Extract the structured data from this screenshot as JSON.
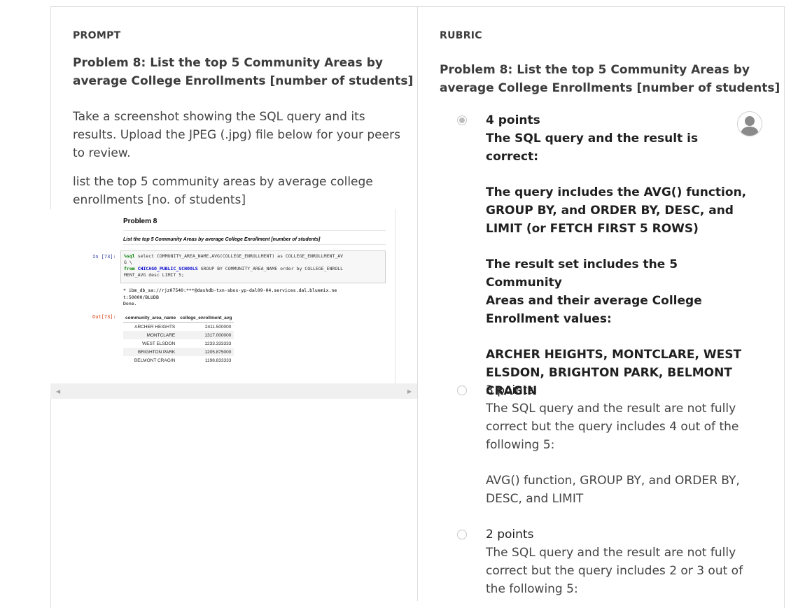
{
  "prompt": {
    "section_label": "PROMPT",
    "title_line1": "Problem 8: List the top 5 Community Areas by",
    "title_line2": "average College Enrollments [number of students]",
    "instructions_line1": "Take a screenshot showing the SQL query and its",
    "instructions_line2": "results. Upload the JPEG (.jpg) file below for your peers",
    "instructions_line3": "to review.",
    "submission_line1": "list the top 5 community areas by average college",
    "submission_line2": "enrollments [no. of students]"
  },
  "notebook": {
    "title": "Problem 8",
    "subtitle": "List the top 5 Community Areas by average College Enrollment [number of students]",
    "in_prompt": "In [73]:",
    "out_prompt": "Out[73]:",
    "code_line1_kw": "%sql",
    "code_line1_rest": " select COMMUNITY_AREA_NAME,AVG(COLLEGE_ENROLLMENT) as COLLEGE_ENROLLMENT_AV",
    "code_line2": "G \\",
    "code_line3_kw": "from",
    "code_line3_tbl": " CHICAGO_PUBLIC_SCHOOLS",
    "code_line3_rest": " GROUP BY COMMUNITY_AREA_NAME order by COLLEGE_ENROLL",
    "code_line4": "MENT_AVG desc LIMIT 5;",
    "stdout_line1": " * ibm_db_sa://rjz07540:***@dashdb-txn-sbox-yp-dal09-04.services.dal.bluemix.ne",
    "stdout_line2": "t:50000/BLUDB",
    "stdout_line3": "Done.",
    "table_headers": [
      "community_area_name",
      "college_enrollment_avg"
    ],
    "table_rows": [
      [
        "ARCHER HEIGHTS",
        "2411.500000"
      ],
      [
        "MONTCLARE",
        "1317.000000"
      ],
      [
        "WEST ELSDON",
        "1233.333333"
      ],
      [
        "BRIGHTON PARK",
        "1205.875000"
      ],
      [
        "BELMONT CRAGIN",
        "1198.833333"
      ]
    ]
  },
  "rubric": {
    "section_label": "RUBRIC",
    "title_line1": "Problem 8: List the top 5 Community Areas by",
    "title_line2": "average College Enrollments [number of students]",
    "options": [
      {
        "points": "4 points",
        "selected": true,
        "lines": [
          "The SQL query and the result is correct:",
          "",
          "The query includes the AVG() function,",
          "GROUP BY, and ORDER BY, DESC, and",
          "LIMIT (or FETCH FIRST 5 ROWS)",
          "",
          "The result set includes the 5 Community",
          "Areas and their average College",
          "Enrollment values:",
          "",
          "ARCHER HEIGHTS, MONTCLARE, WEST",
          "ELSDON, BRIGHTON PARK, BELMONT",
          "CRAGIN"
        ]
      },
      {
        "points": "3 points",
        "selected": false,
        "lines": [
          "The SQL query and the result are not fully",
          "correct but the query includes 4 out of the",
          "following 5:",
          "",
          "AVG() function, GROUP BY, and ORDER BY,",
          "DESC, and LIMIT"
        ]
      },
      {
        "points": "2 points",
        "selected": false,
        "lines": [
          "The SQL query and the result are not fully",
          "correct but the query includes 2 or 3 out of",
          "the following 5:"
        ]
      }
    ]
  },
  "icons": {
    "avatar": "user-avatar-icon",
    "scroll_left": "scroll-left-arrow-icon",
    "scroll_right": "scroll-right-arrow-icon"
  },
  "colors": {
    "radio_selected": "#bdbdbd",
    "border": "#dcdcdc",
    "heading_text": "#3c3c3c"
  }
}
